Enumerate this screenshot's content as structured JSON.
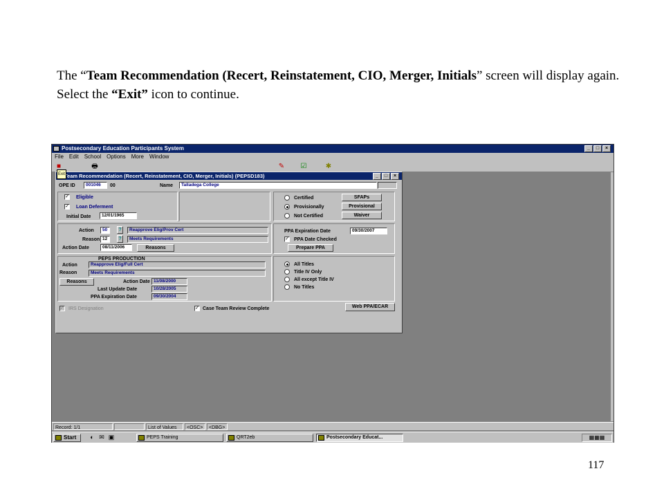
{
  "caption": {
    "p1": "The “",
    "p2": "Team Recommendation (Recert, Reinstatement, CIO, Merger, Initials",
    "p3": "” screen will display again.  Select the ",
    "p4": "“Exit”",
    "p5": " icon to continue."
  },
  "page_number": "117",
  "app": {
    "title": "Postsecondary Education Participants System",
    "menu": [
      "File",
      "Edit",
      "School",
      "Options",
      "More",
      "Window"
    ],
    "window_buttons": [
      "_",
      "□",
      "×"
    ]
  },
  "dialog": {
    "title": "Team Recommendation (Recert, Reinstatement, CIO, Merger, Initials) (PEPSD183)",
    "exit_label": "Exit",
    "ope_id_label": "OPE ID",
    "ope_id": "001046",
    "ope_suffix": "00",
    "name_label": "Name",
    "name": "Talladega College",
    "eligible_label": "Eligible",
    "loan_deferment_label": "Loan Deferment",
    "initial_date_label": "Initial Date",
    "initial_date": "12/01/1965",
    "cert_options": [
      "Certified",
      "Provisionally",
      "Not Certified"
    ],
    "cert_selected": 1,
    "btn_sfaps": "SFAPs",
    "btn_provisional": "Provisional",
    "btn_waiver": "Waiver",
    "action_label": "Action",
    "action_code": "50",
    "action_text": "Reapprove Elig/Prov Cert",
    "reason_label": "Reason",
    "reason_code": "12",
    "reason_text": "Meets Requirements",
    "action_date_label": "Action Date",
    "action_date": "08/11/2006",
    "btn_reasons": "Reasons",
    "ppa_exp_label": "PPA Expiration Date",
    "ppa_exp": "09/30/2007",
    "ppa_checked_label": "PPA Date Checked",
    "btn_prepare_ppa": "Prepare PPA",
    "peps_production_label": "PEPS PRODUCTION",
    "prod_action_label": "Action",
    "prod_action": "Reapprove Elig/Full Cert",
    "prod_reason_label": "Reason",
    "prod_reason": "Meets Requirements",
    "prod_btn_reasons": "Reasons",
    "prod_action_date_label": "Action Date",
    "prod_action_date": "11/08/2000",
    "prod_last_update_label": "Last Update Date",
    "prod_last_update": "10/28/2005",
    "prod_ppa_exp_label": "PPA Expiration Date",
    "prod_ppa_exp": "09/30/2004",
    "title_options": [
      "All Titles",
      "Title IV Only",
      "All except Title IV",
      "No Titles"
    ],
    "title_selected": 0,
    "irs_label": "IRS Designation",
    "case_team_label": "Case Team Review Complete",
    "btn_web_ppa": "Web PPA/ECAR"
  },
  "statusbar": {
    "record": "Record: 1/1",
    "list_of_values": "List of Values",
    "osc": "<OSC>",
    "dbg": "<DBG>"
  },
  "taskbar": {
    "start": "Start",
    "tasks": [
      "PEPS Training",
      "QRT2eb",
      "Postsecondary Educat..."
    ],
    "active_task": 2
  }
}
